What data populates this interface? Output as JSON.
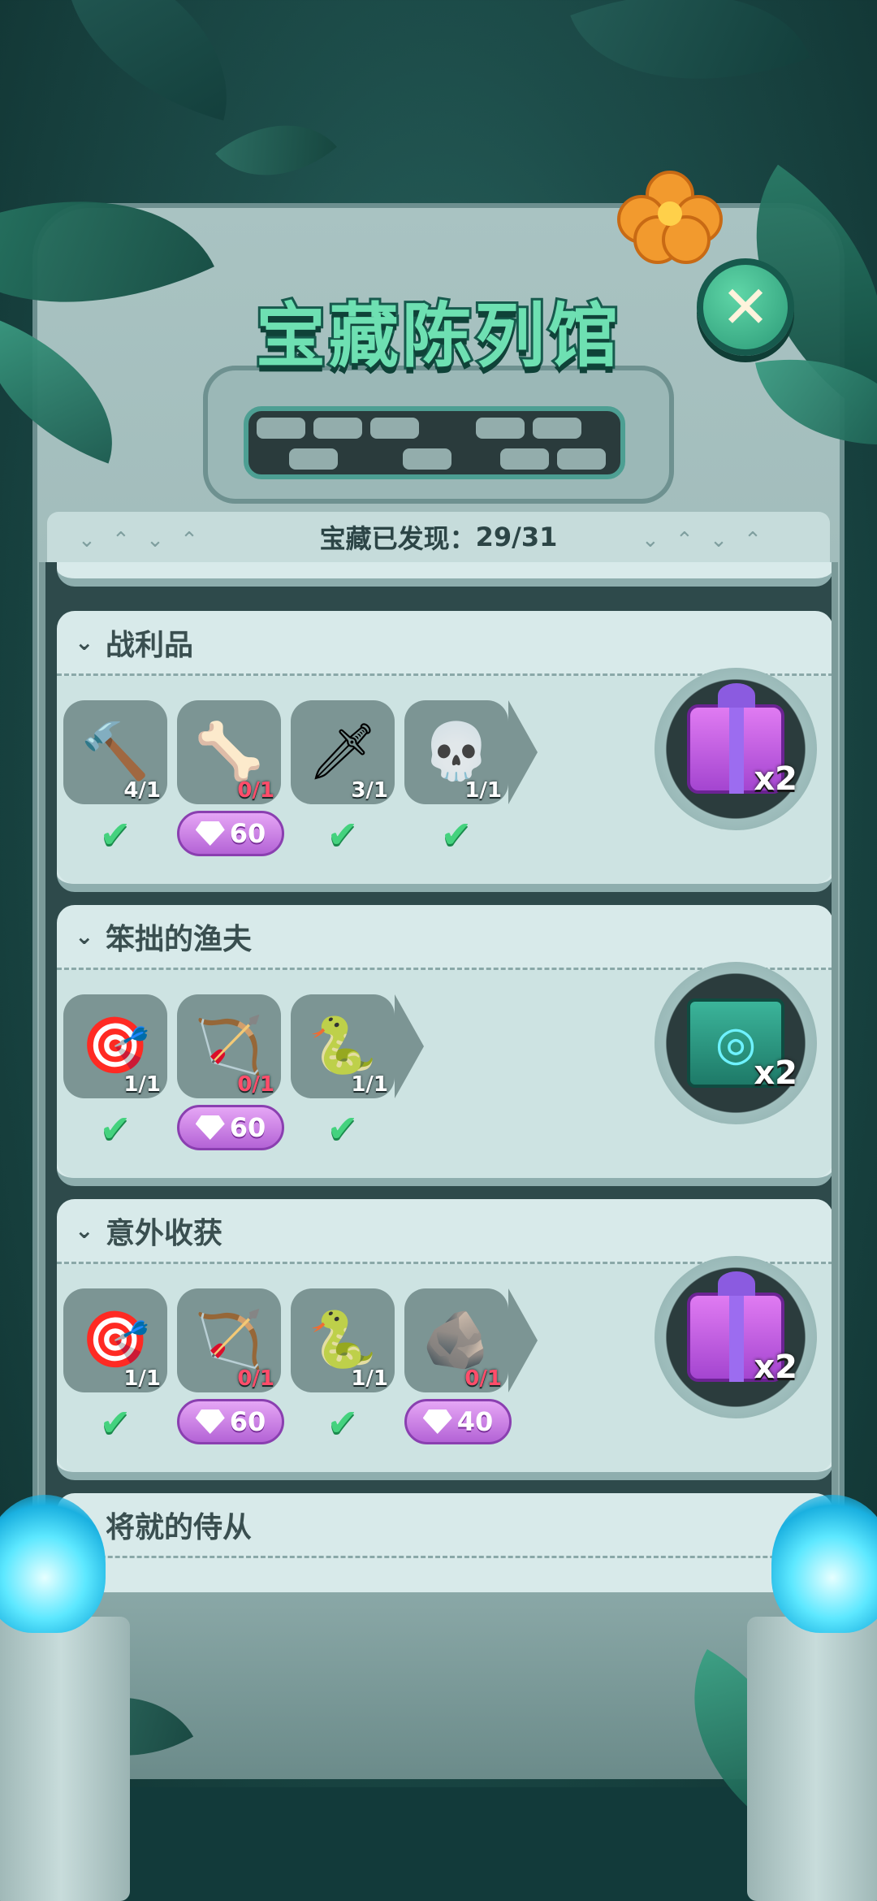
{
  "title": "宝藏陈列馆",
  "progress": {
    "label": "宝藏已发现：",
    "value": "29/31"
  },
  "close_icon": "close-icon",
  "categories": [
    {
      "name": "战利品",
      "items": [
        {
          "icon": "stone-hammer",
          "glyph": "🔨",
          "count": "4/1",
          "status": "collected"
        },
        {
          "icon": "bone",
          "glyph": "🦴",
          "count": "0/1",
          "status": "buy",
          "price": "60"
        },
        {
          "icon": "spear-tip",
          "glyph": "🗡",
          "count": "3/1",
          "status": "collected"
        },
        {
          "icon": "skull-necklace",
          "glyph": "💀",
          "count": "1/1",
          "status": "collected"
        }
      ],
      "reward": {
        "icon": "gift-box-icon",
        "multiplier": "x2"
      }
    },
    {
      "name": "笨拙的渔夫",
      "items": [
        {
          "icon": "target-arrows",
          "glyph": "🎯",
          "count": "1/1",
          "status": "collected"
        },
        {
          "icon": "bow-arrow",
          "glyph": "🏹",
          "count": "0/1",
          "status": "buy",
          "price": "60"
        },
        {
          "icon": "serpent-stone",
          "glyph": "🐍",
          "count": "1/1",
          "status": "collected"
        }
      ],
      "reward": {
        "icon": "eye-ticket-icon",
        "multiplier": "x2"
      }
    },
    {
      "name": "意外收获",
      "items": [
        {
          "icon": "target-arrows",
          "glyph": "🎯",
          "count": "1/1",
          "status": "collected"
        },
        {
          "icon": "bow-arrow",
          "glyph": "🏹",
          "count": "0/1",
          "status": "buy",
          "price": "60"
        },
        {
          "icon": "serpent-stone",
          "glyph": "🐍",
          "count": "1/1",
          "status": "collected"
        },
        {
          "icon": "beast-stone",
          "glyph": "🪨",
          "count": "0/1",
          "status": "buy",
          "price": "40"
        }
      ],
      "reward": {
        "icon": "gift-box-icon",
        "multiplier": "x2"
      }
    },
    {
      "name": "将就的侍从"
    }
  ]
}
